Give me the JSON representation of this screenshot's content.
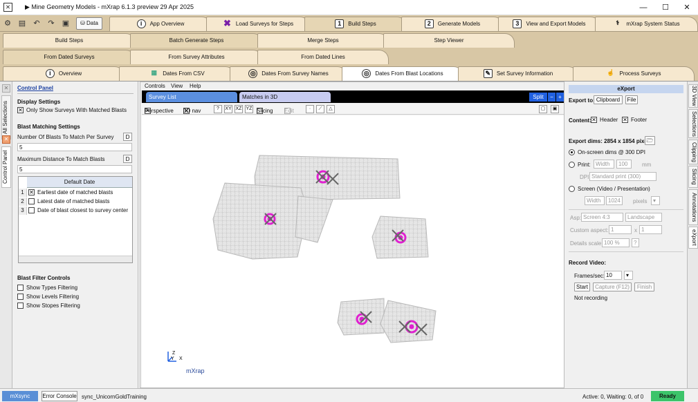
{
  "window": {
    "title": "▶ Mine Geometry Models - mXrap 6.1.3 preview 29 Apr 2025",
    "minimize": "—",
    "maximize": "☐",
    "close": "✕"
  },
  "toolbar": {
    "data_label": "Data"
  },
  "main_tabs": [
    {
      "label": "App Overview",
      "icon": "i"
    },
    {
      "label": "Load Surveys for Steps",
      "icon": "butterfly"
    },
    {
      "label": "Build Steps",
      "icon": "1"
    },
    {
      "label": "Generate Models",
      "icon": "2"
    },
    {
      "label": "View and Export Models",
      "icon": "3"
    },
    {
      "label": "mXrap System Status",
      "icon": "stethoscope"
    }
  ],
  "sub_tabs": [
    "Build Steps",
    "Batch Generate Steps",
    "Merge Steps",
    "Step Viewer"
  ],
  "sub_tabs2": [
    "From Dated Surveys",
    "From Survey Attributes",
    "From Dated Lines"
  ],
  "sub_tabs3": [
    {
      "label": "Overview",
      "icon": "i"
    },
    {
      "label": "Dates From CSV",
      "icon": "csv"
    },
    {
      "label": "Dates From Survey Names",
      "icon": "globe"
    },
    {
      "label": "Dates From Blast Locations",
      "icon": "globe"
    },
    {
      "label": "Set Survey Information",
      "icon": "edit"
    },
    {
      "label": "Process Surveys",
      "icon": "hand"
    }
  ],
  "left_vtabs": [
    "All Selections",
    "Control Panel"
  ],
  "control_panel": {
    "title": "Control Panel",
    "display_settings": "Display Settings",
    "only_show": "Only Show Surveys With Matched Blasts",
    "only_show_checked": "✕",
    "blast_matching": "Blast Matching Settings",
    "num_blasts_label": "Number Of Blasts To Match Per Survey",
    "num_blasts_value": "5",
    "max_dist_label": "Maximum Distance To Match Blasts",
    "max_dist_value": "5",
    "d_button": "D",
    "table_header": "Default Date",
    "rows": [
      {
        "n": "1",
        "checked": "✕",
        "label": "Earliest date of matched blasts"
      },
      {
        "n": "2",
        "checked": "",
        "label": "Latest date of matched blasts"
      },
      {
        "n": "3",
        "checked": "",
        "label": "Date of blast closest to survey center"
      }
    ],
    "filter_title": "Blast Filter Controls",
    "filters": [
      "Show Types Filtering",
      "Show Levels Filtering",
      "Show Stopes Filtering"
    ]
  },
  "viewport": {
    "menu": [
      "Controls",
      "View",
      "Help"
    ],
    "tabs": [
      "Survey List",
      "Matches in 3D"
    ],
    "split": "Split",
    "minus": "−",
    "plus": "+",
    "perspective": "Perspective",
    "nav3d": "3D nav",
    "help": "?",
    "xy": "XY",
    "xz": "XZ",
    "yz": "YZ",
    "slicing": "Slicing",
    "edit": "Edit",
    "brand": "mXrap",
    "axis_x": "X",
    "axis_y": "Y",
    "axis_z": "Z"
  },
  "export_panel": {
    "title": "eXport",
    "export_to": "Export to:",
    "clipboard": "Clipboard",
    "file": "File",
    "content": "Content:",
    "header": "Header",
    "footer": "Footer",
    "dims": "Export dims: 2854 x 1854 pixels",
    "onscreen": "On-screen dims @ 300 DPI",
    "print": "Print:",
    "width": "Width",
    "print_val": "100",
    "mm": "mm",
    "dpi": "DPI",
    "dpi_sel": "Standard print (300)",
    "screen": "Screen (Video / Presentation)",
    "screen_val": "1024",
    "pixels": "pixels",
    "asp": "Asp:",
    "asp_sel": "Screen 4:3",
    "orient": "Landscape",
    "custom_aspect": "Custom aspect:",
    "one": "1",
    "x": "x",
    "details_scale": "Details scale:",
    "scale_val": "100 %",
    "q": "?",
    "record": "Record Video:",
    "fps": "Frames/sec:",
    "fps_val": "10",
    "start": "Start",
    "capture": "Capture (F12)",
    "finish": "Finish",
    "not_recording": "Not recording"
  },
  "right_vtabs": [
    "3D View",
    "Selections",
    "Clipping",
    "Slicing",
    "Annotations",
    "eXport"
  ],
  "status": {
    "mxsync": "mXsync",
    "error_console": "Error Console",
    "sync": "sync_UnicornGoldTraining",
    "active": "Active: 0, Waiting: 0, of   0",
    "ready": "Ready"
  },
  "colors": {
    "tab_bg": "#f6e8cf",
    "tab_bar": "#d8c7a5",
    "accent": "#2060e0",
    "marker": "#e020d0",
    "ready": "#3cc46a"
  }
}
